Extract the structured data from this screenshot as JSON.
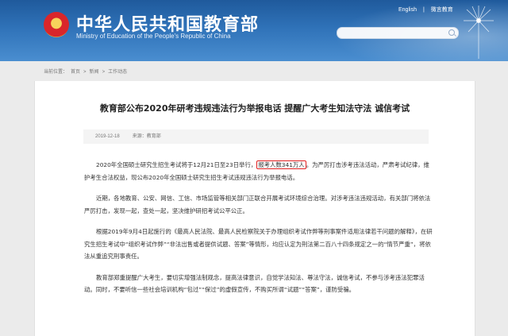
{
  "header": {
    "site_title": "中华人民共和国教育部",
    "site_subtitle": "Ministry of Education of the People's Republic of China",
    "links": [
      "English",
      "微言教育"
    ]
  },
  "breadcrumb": {
    "label": "当前位置：",
    "items": [
      "首页",
      "新闻",
      "工作动态"
    ]
  },
  "article": {
    "title": "教育部公布2020年研考违规违法行为举报电话 提醒广大考生知法守法 诚信考试",
    "date": "2019-12-18",
    "source": "来源：教育部",
    "p1_before": "2020年全国硕士研究生招生考试将于12月21日至23日举行，",
    "p1_highlight": "报考人数341万人",
    "p1_after": "。为严厉打击涉考违法活动，严肃考试纪律，维护考生合法权益，现公布2020年全国硕士研究生招生考试违规违法行为举报电话。",
    "p2": "近期，各地教育、公安、网信、工信、市场监管等相关部门正联合开展考试环境综合治理。对涉考违法违规活动，有关部门将依法严厉打击，发现一起，查处一起，坚决维护研招考试公平公正。",
    "p3": "根据2019年9月4日起施行的《最高人民法院、最高人民检察院关于办理组织考试作弊等刑事案件适用法律若干问题的解释》，在研究生招生考试中“组织考试作弊”“非法出售或者提供试题、答案”等情形，均应认定为刑法第二百八十四条规定之一的“情节严重”，将依法从重追究刑事责任。",
    "p4": "教育部郑重提醒广大考生，要切实增强法制观念，提高法律意识，自觉学法知法、尊法守法，诚信考试，不参与涉考违法犯罪活动。同时，不要听信一些社会培训机构“包过”“保过”的虚假宣传，不购买所谓“试题”“答案”，谨防受骗。"
  },
  "colors": {
    "header_blue": "#2f72b8",
    "highlight_red": "#e02020"
  }
}
